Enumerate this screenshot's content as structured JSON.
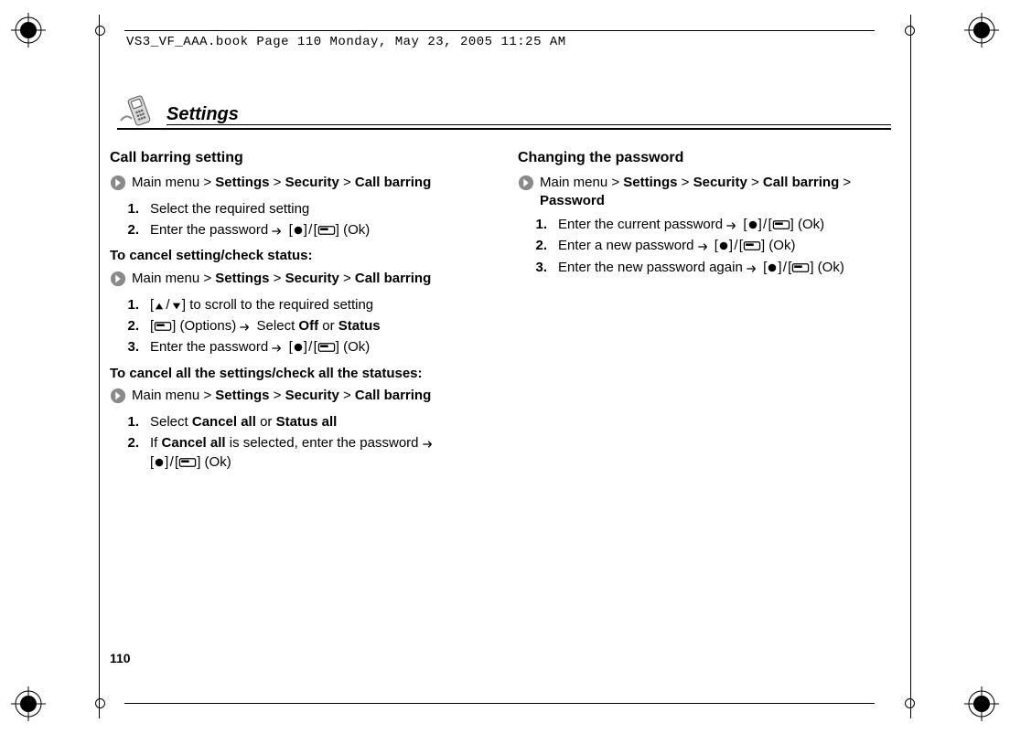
{
  "header_runner": "VS3_VF_AAA.book  Page 110  Monday, May 23, 2005  11:25 AM",
  "section_title": "Settings",
  "page_number": "110",
  "left": {
    "heading": "Call barring setting",
    "bc1_prefix": "Main menu > ",
    "bc1_p1": "Settings",
    "bc1_gt1": " > ",
    "bc1_p2": "Security",
    "bc1_gt2": " > ",
    "bc1_p3": "Call barring",
    "steps1": [
      {
        "n": "1.",
        "t": "Select the required setting"
      },
      {
        "n": "2.",
        "pre": "Enter the password ",
        "post": " (Ok)",
        "icons": "arrow-circle-soft"
      }
    ],
    "cancel_head": "To cancel setting/check status:",
    "bc2_prefix": "Main menu > ",
    "bc2_p1": "Settings",
    "bc2_gt1": " > ",
    "bc2_p2": "Security",
    "bc2_gt2": " > ",
    "bc2_p3": "Call barring",
    "steps2": [
      {
        "n": "1.",
        "pre": "",
        "mid": " to scroll to the required setting",
        "icons": "updown"
      },
      {
        "n": "2.",
        "pre": "",
        "mid": " (Options) ",
        "opt1": "Off",
        "or": " or ",
        "opt2": "Status",
        "icons": "soft-arrow-select"
      },
      {
        "n": "3.",
        "pre": "Enter the password ",
        "post": " (Ok)",
        "icons": "arrow-circle-soft"
      }
    ],
    "cancel_all_head": "To cancel all the settings/check all the statuses:",
    "bc3_prefix": "Main menu > ",
    "bc3_p1": "Settings",
    "bc3_gt1": " > ",
    "bc3_p2": "Security",
    "bc3_gt2": " > ",
    "bc3_p3": "Call barring",
    "steps3": [
      {
        "n": "1.",
        "pre": "Select ",
        "a": "Cancel all",
        "or": " or ",
        "b": "Status all"
      },
      {
        "n": "2.",
        "pre": "If ",
        "a": "Cancel all",
        "mid": " is selected, enter the password ",
        "post": " (Ok)",
        "icons": "arrow-br-circle-soft"
      }
    ]
  },
  "right": {
    "heading": "Changing the password",
    "bc_prefix": "Main menu > ",
    "bc_p1": "Settings",
    "bc_gt1": " > ",
    "bc_p2": "Security",
    "bc_gt2": " > ",
    "bc_p3": "Call barring",
    "bc_gt3": " > ",
    "bc_p4": "Password",
    "steps": [
      {
        "n": "1.",
        "pre": "Enter the current password ",
        "post": " (Ok)"
      },
      {
        "n": "2.",
        "pre": "Enter a new password ",
        "post": " (Ok)"
      },
      {
        "n": "3.",
        "pre": "Enter the new password again ",
        "post": " (Ok)"
      }
    ]
  }
}
